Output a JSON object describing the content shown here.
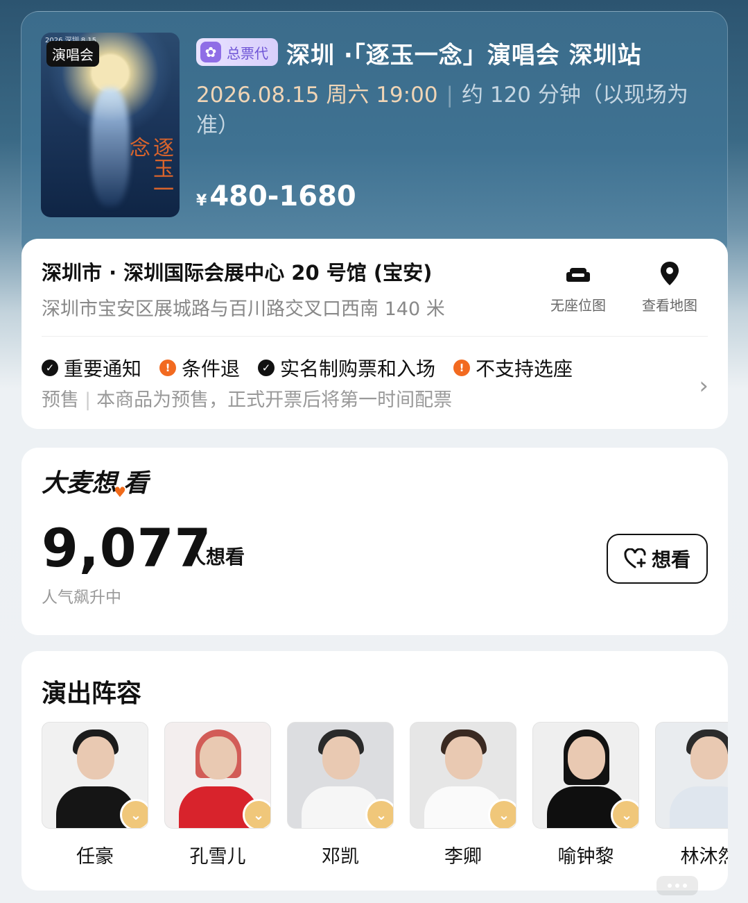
{
  "event": {
    "poster_tag": "演唱会",
    "poster_small_text": "2026 深圳 8.15",
    "poster_calligraphy": "逐玉一念",
    "agency_badge": "总票代",
    "title": "深圳 ·「逐玉一念」演唱会 深圳站",
    "date_time": "2026.08.15 周六 19:00",
    "separator": "|",
    "duration": "约 120 分钟（以现场为准）",
    "price_symbol": "¥",
    "price_range": "480-1680"
  },
  "venue": {
    "name": "深圳市 · 深圳国际会展中心 20 号馆 (宝安)",
    "address": "深圳市宝安区展城路与百川路交叉口西南 140 米",
    "actions": [
      {
        "label": "无座位图",
        "icon": "armchair-icon"
      },
      {
        "label": "查看地图",
        "icon": "location-pin-icon"
      }
    ],
    "notices": [
      {
        "label": "重要通知",
        "icon": "check-circle-icon"
      },
      {
        "label": "条件退",
        "icon": "warning-circle-icon"
      },
      {
        "label": "实名制购票和入场",
        "icon": "check-circle-icon"
      },
      {
        "label": "不支持选座",
        "icon": "warning-circle-icon"
      }
    ],
    "presale_label": "预售",
    "presale_bar": "|",
    "presale_text": "本商品为预售，正式开票后将第一时间配票"
  },
  "want": {
    "logo_part1": "大麦想",
    "logo_part2": "看",
    "count": "9,077",
    "unit": "人想看",
    "sub": "人气飙升中",
    "button_label": "想看"
  },
  "cast": {
    "title": "演出阵容",
    "members": [
      {
        "name": "任豪"
      },
      {
        "name": "孔雪儿"
      },
      {
        "name": "邓凯"
      },
      {
        "name": "李卿"
      },
      {
        "name": "喻钟黎"
      },
      {
        "name": "林沐然"
      }
    ]
  },
  "colors": {
    "accent_orange": "#f26a20",
    "date_gold": "#f0d5b6",
    "agency_purple": "#6e54d6",
    "fav_gold": "#f0c77a"
  }
}
